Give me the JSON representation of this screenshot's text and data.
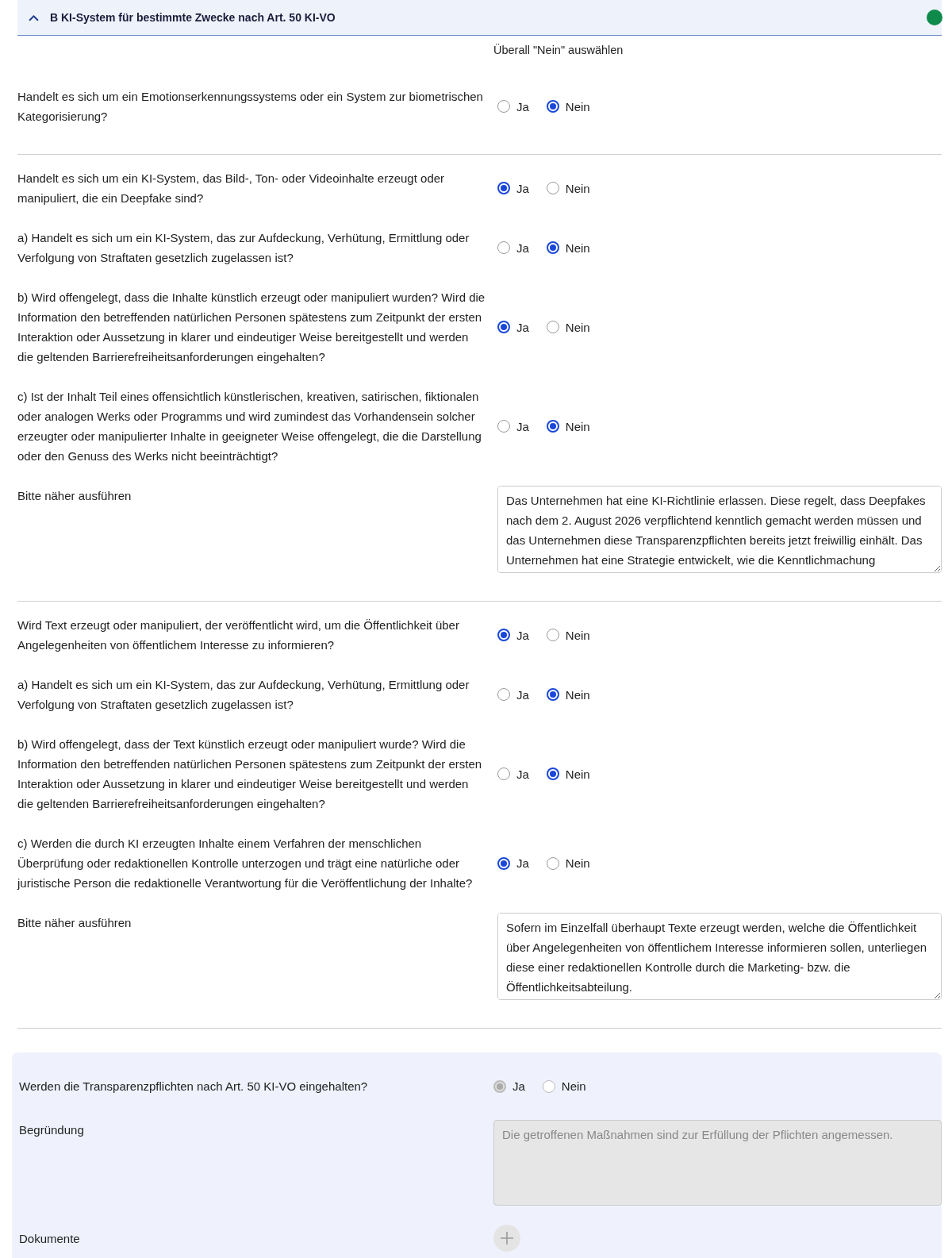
{
  "section": {
    "title": "B KI-System für bestimmte Zwecke nach Art. 50 KI-VO",
    "expanded": true,
    "completed": true
  },
  "select_all_no": "Überall \"Nein\" auswählen",
  "groups": [
    {
      "questions": [
        {
          "text": "Handelt es sich um ein Emotionserkennungssystems oder ein System zur biometrischen Kategorisierung?",
          "options": [
            {
              "label": "Ja",
              "selected": false
            },
            {
              "label": "Nein",
              "selected": true
            }
          ]
        }
      ]
    },
    {
      "questions": [
        {
          "text": "Handelt es sich um ein KI-System, das Bild-, Ton- oder Videoinhalte erzeugt oder manipuliert, die ein Deepfake sind?",
          "options": [
            {
              "label": "Ja",
              "selected": true
            },
            {
              "label": "Nein",
              "selected": false
            }
          ]
        },
        {
          "text": "a) Handelt es sich um ein KI-System, das zur Aufdeckung, Verhütung, Ermittlung oder Verfolgung von Straftaten gesetzlich zugelassen ist?",
          "options": [
            {
              "label": "Ja",
              "selected": false
            },
            {
              "label": "Nein",
              "selected": true
            }
          ]
        },
        {
          "text": "b) Wird offengelegt, dass die Inhalte künstlich erzeugt oder manipuliert wurden? Wird die Information den betreffenden natürlichen Personen spätestens zum Zeitpunkt der ersten Interaktion oder Aussetzung in klarer und eindeutiger Weise bereitgestellt und werden die geltenden Barrierefreiheitsanforderungen eingehalten?",
          "options": [
            {
              "label": "Ja",
              "selected": true
            },
            {
              "label": "Nein",
              "selected": false
            }
          ]
        },
        {
          "text": "c) Ist der Inhalt Teil eines offensichtlich künstlerischen, kreativen, satirischen, fiktionalen oder analogen Werks oder Programms und wird zumindest das Vorhandensein solcher erzeugter oder manipulierter Inhalte in geeigneter Weise offengelegt, die die Darstellung oder den Genuss des Werks nicht beeinträchtigt?",
          "options": [
            {
              "label": "Ja",
              "selected": false
            },
            {
              "label": "Nein",
              "selected": true
            }
          ]
        }
      ],
      "explanation": {
        "label": "Bitte näher ausführen",
        "value": "Das Unternehmen hat eine KI-Richtlinie erlassen. Diese regelt, dass Deepfakes nach dem 2. August 2026 verpflichtend kenntlich gemacht werden müssen und das Unternehmen diese Transparenzpflichten bereits jetzt freiwillig einhält. Das Unternehmen hat eine Strategie entwickelt, wie die Kenntlichmachung"
      }
    },
    {
      "questions": [
        {
          "text": "Wird Text erzeugt oder manipuliert, der veröffentlicht wird, um die Öffentlichkeit über Angelegenheiten von öffentlichem Interesse zu informieren?",
          "options": [
            {
              "label": "Ja",
              "selected": true
            },
            {
              "label": "Nein",
              "selected": false
            }
          ]
        },
        {
          "text": "a) Handelt es sich um ein KI-System, das zur Aufdeckung, Verhütung, Ermittlung oder Verfolgung von Straftaten gesetzlich zugelassen ist?",
          "options": [
            {
              "label": "Ja",
              "selected": false
            },
            {
              "label": "Nein",
              "selected": true
            }
          ]
        },
        {
          "text": "b) Wird offengelegt, dass der Text künstlich erzeugt oder manipuliert wurde? Wird die Information den betreffenden natürlichen Personen spätestens zum Zeitpunkt der ersten Interaktion oder Aussetzung in klarer und eindeutiger Weise bereitgestellt und werden die geltenden Barrierefreiheitsanforderungen eingehalten?",
          "options": [
            {
              "label": "Ja",
              "selected": false
            },
            {
              "label": "Nein",
              "selected": true
            }
          ]
        },
        {
          "text": "c) Werden die durch KI erzeugten Inhalte einem Verfahren der menschlichen Überprüfung oder redaktionellen Kontrolle unterzogen und trägt eine natürliche oder juristische Person die redaktionelle Verantwortung für die Veröffentlichung der Inhalte?",
          "options": [
            {
              "label": "Ja",
              "selected": true
            },
            {
              "label": "Nein",
              "selected": false
            }
          ]
        }
      ],
      "explanation": {
        "label": "Bitte näher ausführen",
        "value": "Sofern im Einzelfall überhaupt Texte erzeugt werden, welche die Öffentlichkeit über Angelegenheiten von öffentlichem Interesse informieren sollen, unterliegen diese einer redaktionellen Kontrolle durch die Marketing- bzw. die Öffentlichkeitsabteilung."
      }
    }
  ],
  "summary": {
    "question": {
      "text": "Werden die Transparenzpflichten nach Art. 50 KI-VO eingehalten?",
      "disabled": true,
      "options": [
        {
          "label": "Ja",
          "selected": true
        },
        {
          "label": "Nein",
          "selected": false
        }
      ]
    },
    "reason": {
      "label": "Begründung",
      "value": "Die getroffenen Maßnahmen sind zur Erfüllung der Pflichten angemessen.",
      "disabled": true
    },
    "documents": {
      "label": "Dokumente",
      "disabled": true
    }
  }
}
